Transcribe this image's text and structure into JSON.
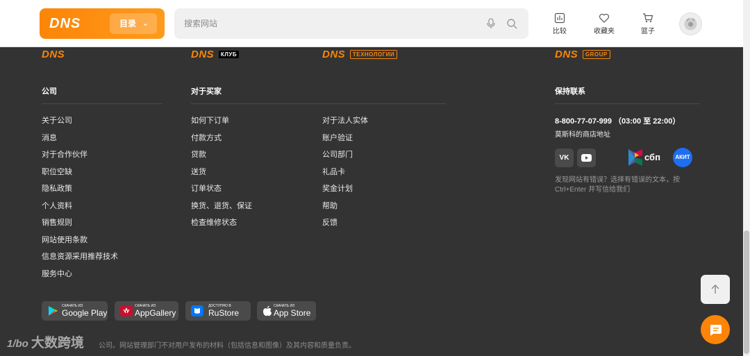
{
  "header": {
    "brand_logo": "DNS",
    "catalog_label": "目录",
    "search_placeholder": "搜索网站",
    "compare_label": "比较",
    "favorites_label": "收藏夹",
    "cart_label": "篮子"
  },
  "footer": {
    "logos": {
      "dns": "DNS",
      "club_text": "DNS",
      "club_tag": "КЛУБ",
      "tech_text": "DNS",
      "tech_tag": "ТЕХНОЛОГИИ",
      "group_text": "DNS",
      "group_tag": "GROUP"
    },
    "company": {
      "title": "公司",
      "links": [
        "关于公司",
        "消息",
        "对于合作伙伴",
        "职位空缺",
        "隐私政策",
        "个人资料",
        "销售规则",
        "网站使用条款",
        "信息资源采用推荐技术",
        "服务中心"
      ]
    },
    "buyers": {
      "title": "对于买家",
      "links_left": [
        "如何下订单",
        "付款方式",
        "贷款",
        "送货",
        "订单状态",
        "换货、退货、保证",
        "检查维修状态"
      ],
      "links_right": [
        "对于法人实体",
        "账户验证",
        "公司部门",
        "礼品卡",
        "奖金计划",
        "帮助",
        "反馈"
      ]
    },
    "contact": {
      "title": "保持联系",
      "phone": "8-800-77-07-999 （03:00 至 22:00）",
      "store_address": "莫斯科的商店地址",
      "vk": "VK",
      "sbp": "сбп",
      "akit": "АКИТ",
      "error_note": "发现网站有错误？选择有错误的文本，按 Ctrl+Enter 并写信给我们"
    },
    "app_badges": [
      {
        "small": "СКАЧАТЬ ИЗ",
        "big": "Google Play"
      },
      {
        "small": "СКАЧАТЬ ИЗ",
        "big": "AppGallery"
      },
      {
        "small": "Доступно в",
        "big": "RuStore"
      },
      {
        "small": "СКАЧАТЬ ИЗ",
        "big": "App Store"
      }
    ],
    "copyright": "公司。网站管理部门不对用户发布的材料（包括信息和图像）及其内容和质量负责。",
    "watermark": "大数跨境",
    "watermark_mark": "1/bo"
  },
  "colors": {
    "brand_orange": "#fc8507",
    "footer_bg": "#333333"
  }
}
